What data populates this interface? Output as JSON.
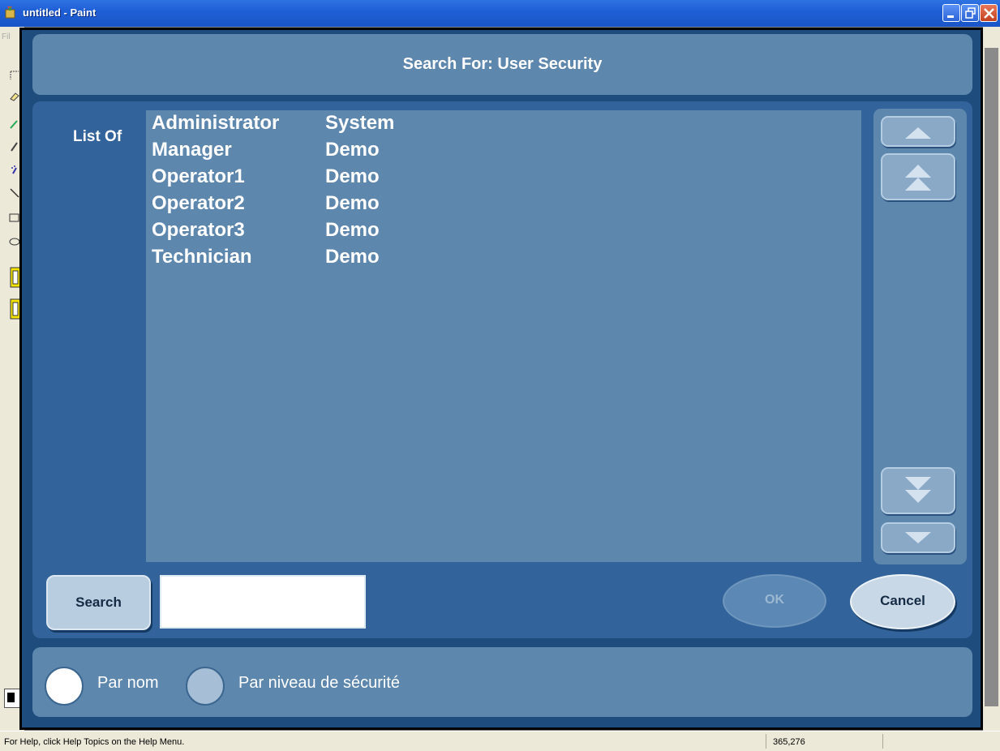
{
  "window": {
    "title": "untitled - Paint",
    "menu_stub": "Fil"
  },
  "statusbar": {
    "help_text": "For Help, click Help Topics on the Help Menu.",
    "coords": "365,276"
  },
  "dialog": {
    "title": "Search For: User Security",
    "list_label": "List Of",
    "rows": [
      {
        "name": "Administrator",
        "domain": "System"
      },
      {
        "name": "Manager",
        "domain": "Demo"
      },
      {
        "name": "Operator1",
        "domain": "Demo"
      },
      {
        "name": "Operator2",
        "domain": "Demo"
      },
      {
        "name": "Operator3",
        "domain": "Demo"
      },
      {
        "name": "Technician",
        "domain": "Demo"
      }
    ],
    "search_label": "Search",
    "search_value": "",
    "ok_label": "OK",
    "cancel_label": "Cancel",
    "radio_by_name": "Par nom",
    "radio_by_level": "Par niveau de sécurité",
    "selected_radio": "Par nom"
  },
  "colors": {
    "dialog_bg": "#1d4c7d",
    "panel": "#5e87ae",
    "main_panel": "#32639a",
    "titlebar": "#1f5fd6"
  }
}
